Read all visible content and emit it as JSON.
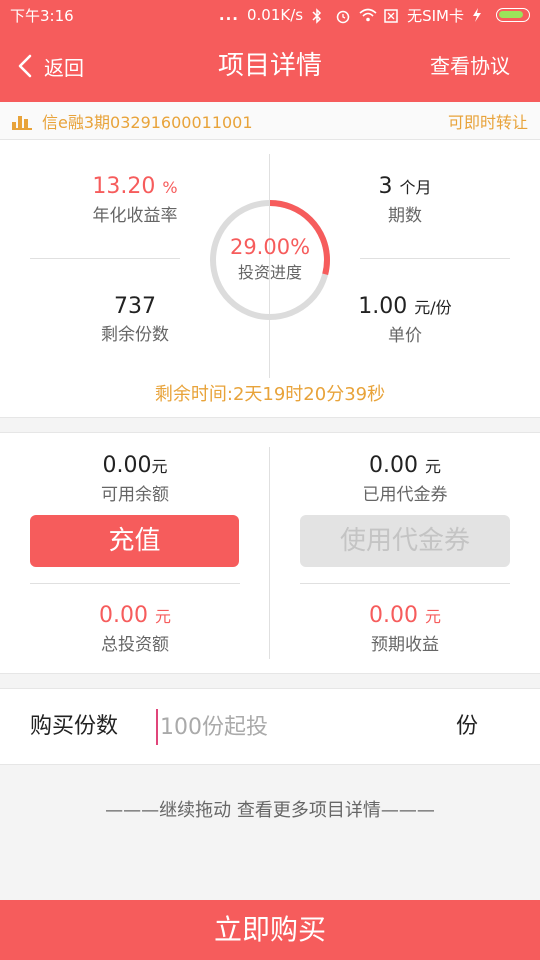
{
  "status_bar": {
    "time": "下午3:16",
    "network_speed": "0.01K/s",
    "sim": "无SIM卡",
    "dots": "..."
  },
  "header": {
    "back_label": "返回",
    "title": "项目详情",
    "agreement_label": "查看协议"
  },
  "info_strip": {
    "product_name": "信e融3期03291600011001",
    "transfer_note": "可即时转让"
  },
  "stats": {
    "annual_rate_value": "13.20",
    "annual_rate_unit": "%",
    "annual_rate_label": "年化收益率",
    "period_value": "3",
    "period_unit": "个月",
    "period_label": "期数",
    "progress_value": "29.00%",
    "progress_fraction": 0.29,
    "progress_label": "投资进度",
    "remaining_shares_value": "737",
    "remaining_shares_label": "剩余份数",
    "unit_price_value": "1.00",
    "unit_price_unit": "元/份",
    "unit_price_label": "单价",
    "remaining_time": "剩余时间:2天19时20分39秒"
  },
  "account": {
    "available_value": "0.00",
    "available_unit": "元",
    "available_label": "可用余额",
    "used_voucher_value": "0.00",
    "used_voucher_unit": "元",
    "used_voucher_label": "已用代金券",
    "recharge_button": "充值",
    "voucher_button": "使用代金券",
    "total_invest_value": "0.00",
    "total_invest_unit": "元",
    "total_invest_label": "总投资额",
    "expected_income_value": "0.00",
    "expected_income_unit": "元",
    "expected_income_label": "预期收益"
  },
  "purchase": {
    "label": "购买份数",
    "placeholder": "100份起投",
    "value": "",
    "unit": "份"
  },
  "more_details": "———继续拖动 查看更多项目详情———",
  "buy_button": "立即购买",
  "colors": {
    "brand_red": "#f65c5c",
    "accent_orange": "#e8a33a",
    "disabled_gray": "#e3e3e3"
  }
}
